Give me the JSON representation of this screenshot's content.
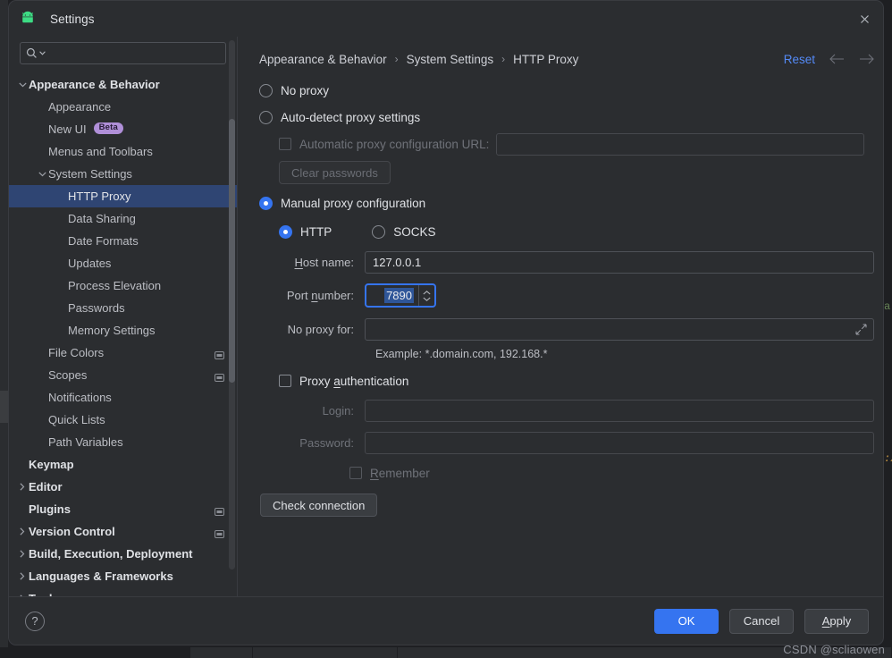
{
  "window": {
    "title": "Settings",
    "app_icon": "android-icon",
    "close_icon": "close-icon"
  },
  "search": {
    "placeholder": "",
    "value": "",
    "icon": "search-icon",
    "dropdown_icon": "chevron-down-icon"
  },
  "sidebar": {
    "items": [
      {
        "label": "Appearance & Behavior",
        "level": 0,
        "twisty": "expanded",
        "bold": true,
        "selected": false,
        "badge": null
      },
      {
        "label": "Appearance",
        "level": 1,
        "twisty": "none",
        "bold": false,
        "selected": false,
        "badge": null
      },
      {
        "label": "New UI",
        "level": 1,
        "twisty": "none",
        "bold": false,
        "selected": false,
        "badge": null,
        "tag": "Beta"
      },
      {
        "label": "Menus and Toolbars",
        "level": 1,
        "twisty": "none",
        "bold": false,
        "selected": false,
        "badge": null
      },
      {
        "label": "System Settings",
        "level": 1,
        "twisty": "expanded",
        "bold": false,
        "selected": false,
        "badge": null
      },
      {
        "label": "HTTP Proxy",
        "level": 2,
        "twisty": "none",
        "bold": false,
        "selected": true,
        "badge": null
      },
      {
        "label": "Data Sharing",
        "level": 2,
        "twisty": "none",
        "bold": false,
        "selected": false,
        "badge": null
      },
      {
        "label": "Date Formats",
        "level": 2,
        "twisty": "none",
        "bold": false,
        "selected": false,
        "badge": null
      },
      {
        "label": "Updates",
        "level": 2,
        "twisty": "none",
        "bold": false,
        "selected": false,
        "badge": null
      },
      {
        "label": "Process Elevation",
        "level": 2,
        "twisty": "none",
        "bold": false,
        "selected": false,
        "badge": null
      },
      {
        "label": "Passwords",
        "level": 2,
        "twisty": "none",
        "bold": false,
        "selected": false,
        "badge": null
      },
      {
        "label": "Memory Settings",
        "level": 2,
        "twisty": "none",
        "bold": false,
        "selected": false,
        "badge": null
      },
      {
        "label": "File Colors",
        "level": 1,
        "twisty": "none",
        "bold": false,
        "selected": false,
        "badge": "project-badge-icon"
      },
      {
        "label": "Scopes",
        "level": 1,
        "twisty": "none",
        "bold": false,
        "selected": false,
        "badge": "project-badge-icon"
      },
      {
        "label": "Notifications",
        "level": 1,
        "twisty": "none",
        "bold": false,
        "selected": false,
        "badge": null
      },
      {
        "label": "Quick Lists",
        "level": 1,
        "twisty": "none",
        "bold": false,
        "selected": false,
        "badge": null
      },
      {
        "label": "Path Variables",
        "level": 1,
        "twisty": "none",
        "bold": false,
        "selected": false,
        "badge": null
      },
      {
        "label": "Keymap",
        "level": 0,
        "twisty": "none",
        "bold": true,
        "selected": false,
        "badge": null
      },
      {
        "label": "Editor",
        "level": 0,
        "twisty": "collapsed",
        "bold": true,
        "selected": false,
        "badge": null
      },
      {
        "label": "Plugins",
        "level": 0,
        "twisty": "none",
        "bold": true,
        "selected": false,
        "badge": "project-badge-icon"
      },
      {
        "label": "Version Control",
        "level": 0,
        "twisty": "collapsed",
        "bold": true,
        "selected": false,
        "badge": "project-badge-icon"
      },
      {
        "label": "Build, Execution, Deployment",
        "level": 0,
        "twisty": "collapsed",
        "bold": true,
        "selected": false,
        "badge": null
      },
      {
        "label": "Languages & Frameworks",
        "level": 0,
        "twisty": "collapsed",
        "bold": true,
        "selected": false,
        "badge": null
      },
      {
        "label": "Tools",
        "level": 0,
        "twisty": "collapsed",
        "bold": true,
        "selected": false,
        "badge": null
      }
    ]
  },
  "content": {
    "breadcrumb": [
      "Appearance & Behavior",
      "System Settings",
      "HTTP Proxy"
    ],
    "breadcrumb_separator": "›",
    "reset_label": "Reset",
    "back_icon": "arrow-left-icon",
    "forward_icon": "arrow-right-icon",
    "proxy_mode": {
      "no_proxy_label": "No proxy",
      "no_proxy_selected": false,
      "auto_detect_label": "Auto-detect proxy settings",
      "auto_detect_selected": false,
      "manual_label": "Manual proxy configuration",
      "manual_selected": true
    },
    "auto_pac": {
      "checkbox_label": "Automatic proxy configuration URL:",
      "checked": false,
      "enabled": false,
      "url_value": "",
      "clear_passwords_label": "Clear passwords",
      "clear_passwords_enabled": false
    },
    "manual": {
      "http_label": "HTTP",
      "http_selected": true,
      "socks_label": "SOCKS",
      "socks_selected": false,
      "host_label_pre": "H",
      "host_label_post": "ost name:",
      "host_value": "127.0.0.1",
      "port_label_pre": "Port ",
      "port_label_mn": "n",
      "port_label_post": "umber:",
      "port_value": "7890",
      "port_focused": true,
      "port_selected_text": true,
      "no_proxy_for_label": "No proxy for:",
      "no_proxy_for_value": "",
      "expand_icon": "expand-icon",
      "example_hint": "Example: *.domain.com, 192.168.*"
    },
    "auth": {
      "checkbox_label_pre": "Proxy ",
      "checkbox_label_mn": "a",
      "checkbox_label_post": "uthentication",
      "checked": false,
      "login_label": "Login:",
      "login_value": "",
      "password_label": "Password:",
      "password_value": "",
      "remember_label_mn": "R",
      "remember_label_post": "emember",
      "remember_checked": false,
      "enabled": false
    },
    "check_connection_label": "Check connection"
  },
  "footer": {
    "help_label": "?",
    "ok_label": "OK",
    "cancel_label": "Cancel",
    "apply_label_mn": "A",
    "apply_label_post": "pply"
  },
  "watermark": "CSDN @scliaowen",
  "background": {
    "code_snippet_1": "a",
    "code_snippet_2": ":/"
  },
  "colors": {
    "accent_blue": "#3574f0",
    "link_blue": "#548af7",
    "selection_row": "#2f4573",
    "dialog_bg": "#2b2d30",
    "beta_badge": "#b08fd8"
  }
}
